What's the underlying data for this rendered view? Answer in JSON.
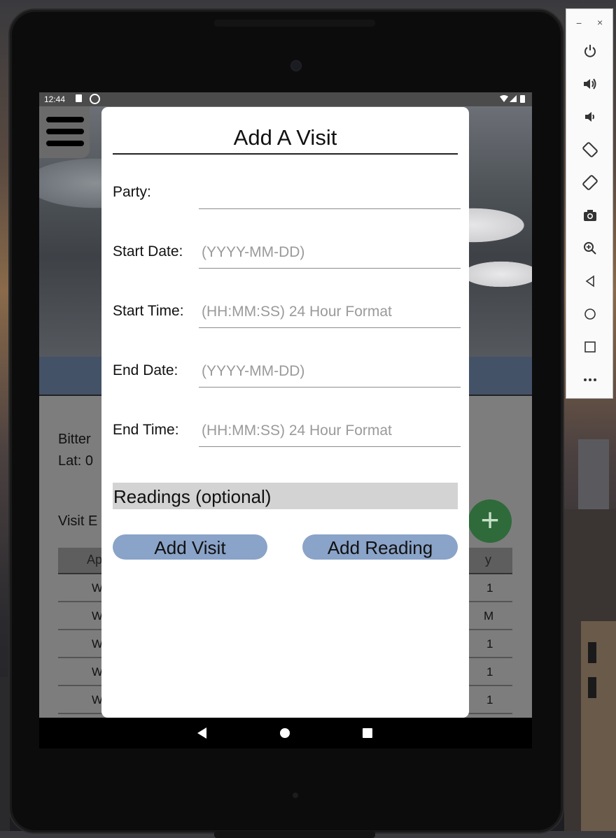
{
  "statusbar": {
    "time": "12:44"
  },
  "background": {
    "location_line1": "Bitter",
    "location_line2": "Lat: 0",
    "visits_label": "Visit E",
    "table_header_left": "Ap",
    "table_header_right": "y",
    "rows": [
      {
        "left": "W",
        "right": "1"
      },
      {
        "left": "W",
        "right": "M"
      },
      {
        "left": "W",
        "right": "1"
      },
      {
        "left": "W",
        "right": "1"
      },
      {
        "left": "W",
        "right": "1"
      }
    ],
    "fab_label": "+"
  },
  "dialog": {
    "title": "Add A Visit",
    "fields": {
      "party": {
        "label": "Party:",
        "value": "",
        "placeholder": ""
      },
      "start_date": {
        "label": "Start Date:",
        "value": "",
        "placeholder": "(YYYY-MM-DD)"
      },
      "start_time": {
        "label": "Start Time:",
        "value": "",
        "placeholder": "(HH:MM:SS) 24 Hour Format"
      },
      "end_date": {
        "label": "End Date:",
        "value": "",
        "placeholder": "(YYYY-MM-DD)"
      },
      "end_time": {
        "label": "End Time:",
        "value": "",
        "placeholder": "(HH:MM:SS) 24 Hour Format"
      }
    },
    "readings_header": "Readings (optional)",
    "add_visit_label": "Add Visit",
    "add_reading_label": "Add Reading"
  },
  "emulator_toolbar": {
    "minimize": "−",
    "close": "×",
    "icons": [
      "power-icon",
      "volume-up-icon",
      "volume-down-icon",
      "rotate-left-icon",
      "rotate-right-icon",
      "camera-icon",
      "zoom-icon",
      "back-icon",
      "home-icon",
      "overview-icon",
      "more-icon"
    ]
  },
  "colors": {
    "dialog_button": "#8aa3c8",
    "readings_bg": "#d3d3d3",
    "fab": "#2e6a3a"
  }
}
